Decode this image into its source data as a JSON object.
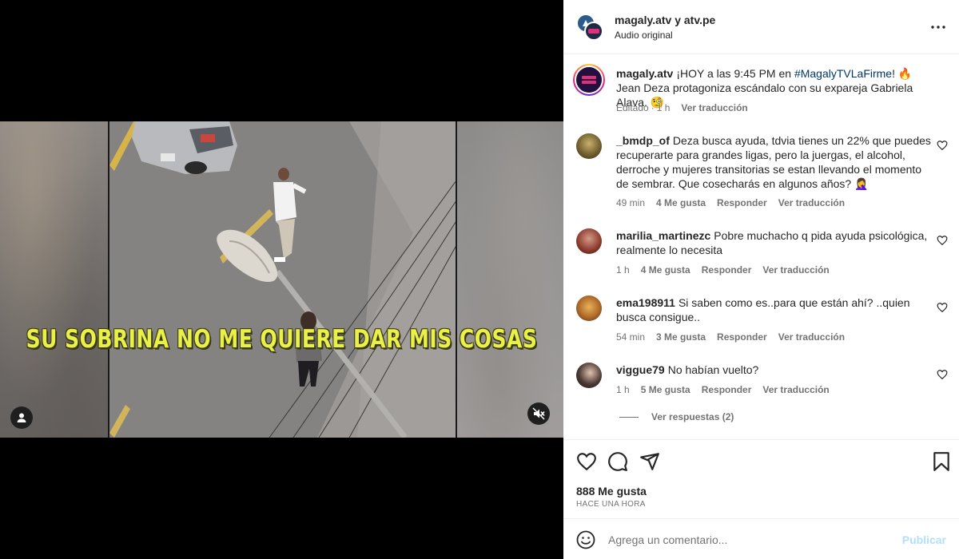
{
  "media": {
    "subtitle": "SU SOBRINA NO ME QUIERE DAR MIS COSAS",
    "user_tag_icon": "user-icon",
    "mute_icon": "speaker-muted-icon"
  },
  "header": {
    "owner": "magaly.atv y atv.pe",
    "audio": "Audio original",
    "more_icon": "more-horizontal-icon"
  },
  "caption": {
    "user": "magaly.atv",
    "text_before": "¡HOY a las 9:45 PM en ",
    "hashtag": "#MagalyTVLaFirme",
    "text_after": "! 🔥 Jean Deza protagoniza escándalo con su expareja Gabriela Alava. 🧐",
    "edited": "Editado",
    "time": "1 h",
    "translate": "Ver traducción"
  },
  "comments": [
    {
      "user": "_bmdp_of",
      "text": "Deza busca ayuda, tdvia tienes un 22% que puedes recuperarte para grandes ligas, pero la juergas, el alcohol, derroche y mujeres transitorias se estan llevando el momento de sembrar. Que cosecharás en algunos años? 🤦‍♀️",
      "time": "49 min",
      "likes": "4 Me gusta",
      "reply": "Responder",
      "translate": "Ver traducción"
    },
    {
      "user": "marilia_martinezc",
      "text": "Pobre muchacho q pida ayuda psicológica, realmente lo necesita",
      "time": "1 h",
      "likes": "4 Me gusta",
      "reply": "Responder",
      "translate": "Ver traducción"
    },
    {
      "user": "ema198911",
      "text": "Si saben como es..para que están ahí? ..quien busca consigue..",
      "time": "54 min",
      "likes": "3 Me gusta",
      "reply": "Responder",
      "translate": "Ver traducción"
    },
    {
      "user": "viggue79",
      "text": "No habían vuelto?",
      "time": "1 h",
      "likes": "5 Me gusta",
      "reply": "Responder",
      "translate": "Ver traducción"
    }
  ],
  "view_replies": "Ver respuestas (2)",
  "actions": {
    "like_icon": "heart-icon",
    "comment_icon": "comment-icon",
    "share_icon": "send-icon",
    "save_icon": "bookmark-icon",
    "likes": "888 Me gusta",
    "posted": "HACE UNA HORA"
  },
  "comment_bar": {
    "emoji_icon": "emoji-icon",
    "placeholder": "Agrega un comentario...",
    "publish": "Publicar"
  },
  "colors": {
    "link": "#00376b",
    "muted": "#737373",
    "publish_disabled": "#b2dffc",
    "subtitle": "#e9f048"
  }
}
